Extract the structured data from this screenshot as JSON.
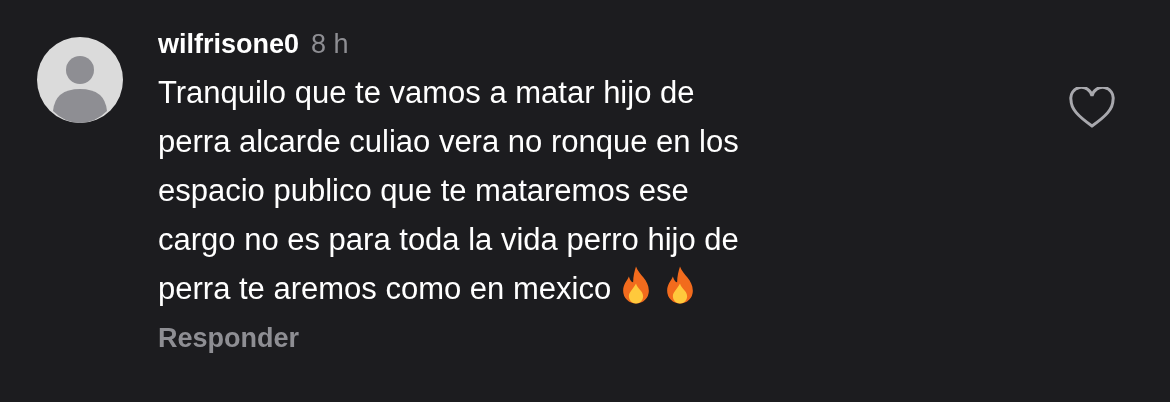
{
  "comment": {
    "username": "wilfrisone0",
    "time": "8 h",
    "lines": [
      "Tranquilo que te vamos a matar hijo de",
      "perra alcarde culiao vera no ronque en los",
      "espacio publico que te mataremos ese",
      "cargo no es para toda la vida perro hijo de",
      "perra te aremos como en mexico"
    ],
    "liked": false,
    "reply": "Responder"
  }
}
